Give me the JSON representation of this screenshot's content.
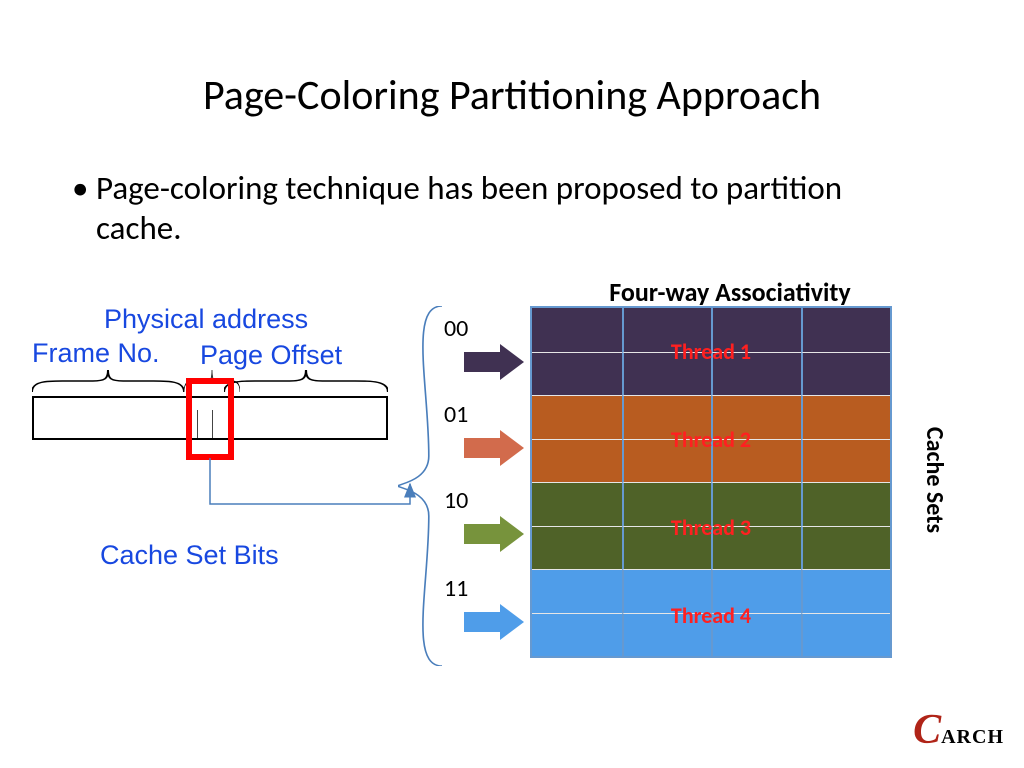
{
  "title": "Page-Coloring Partitioning Approach",
  "bullet": "Page-coloring technique has been proposed to partition cache.",
  "labels": {
    "assoc": "Four-way Associativity",
    "phys": "Physical address",
    "frame": "Frame No.",
    "offset": "Page Offset",
    "csb": "Cache Set Bits",
    "sets": "Cache Sets"
  },
  "bits": [
    "00",
    "01",
    "10",
    "11"
  ],
  "threads": [
    "Thread 1",
    "Thread 2",
    "Thread 3",
    "Thread 4"
  ],
  "colors": {
    "t1": "#403152",
    "t2": "#b85c20",
    "t3": "#4f6228",
    "t4": "#4f9de9",
    "arrow1": "#403152",
    "arrow2": "#d26b4c",
    "arrow3": "#77933c",
    "arrow4": "#4f9de9"
  },
  "logo": {
    "c": "C",
    "rest": "ARCH"
  }
}
